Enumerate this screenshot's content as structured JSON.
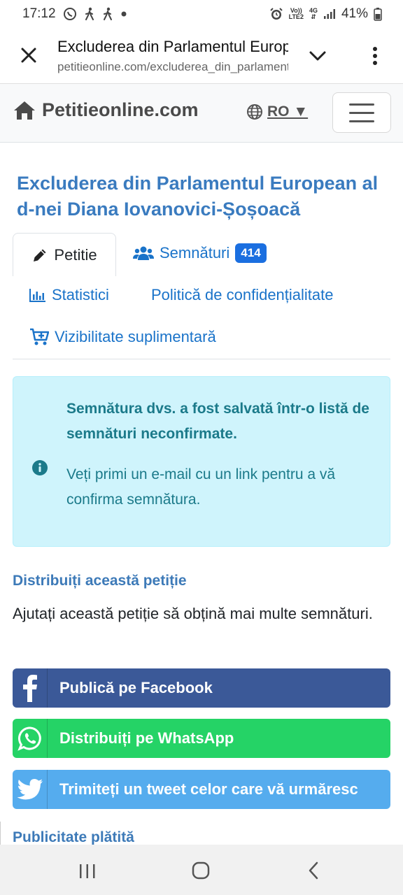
{
  "status_bar": {
    "time": "17:12",
    "volte_line1": "Vo))",
    "volte_line2": "LTE2",
    "network": "4G",
    "battery": "41%"
  },
  "browser": {
    "page_title": "Excluderea din Parlamentul European",
    "url": "petitieonline.com/excluderea_din_parlamentul_european"
  },
  "site": {
    "brand": "Petitieonline.com",
    "language": "RO ▼"
  },
  "petition": {
    "title": "Excluderea din Parlamentul European al d-nei Diana Iovanovici-Șoșoacă"
  },
  "tabs": {
    "petition": "Petitie",
    "signatures": "Semnături",
    "signatures_count": "414",
    "statistics": "Statistici",
    "privacy": "Politică de confidențialitate",
    "visibility": "Vizibilitate suplimentară"
  },
  "alert": {
    "strong": "Semnătura dvs. a fost salvată într-o listă de semnături neconfirmate.",
    "text": "Veți primi un e-mail cu un link pentru a vă confirma semnătura."
  },
  "share": {
    "title": "Distribuiți această petiție",
    "description": "Ajutați această petiție să obțină mai multe semnături.",
    "facebook": "Publică pe Facebook",
    "whatsapp": "Distribuiți pe WhatsApp",
    "twitter": "Trimiteți un tweet celor care vă urmăresc"
  },
  "paid": {
    "title": "Publicitate plătită"
  },
  "colors": {
    "link": "#1a73c9",
    "heading": "#3a7bbf",
    "alert_bg": "#cff4fc",
    "alert_text": "#1b7a8a",
    "facebook": "#3b5998",
    "whatsapp": "#25d366",
    "twitter": "#55acee",
    "badge": "#1b6fe0"
  }
}
